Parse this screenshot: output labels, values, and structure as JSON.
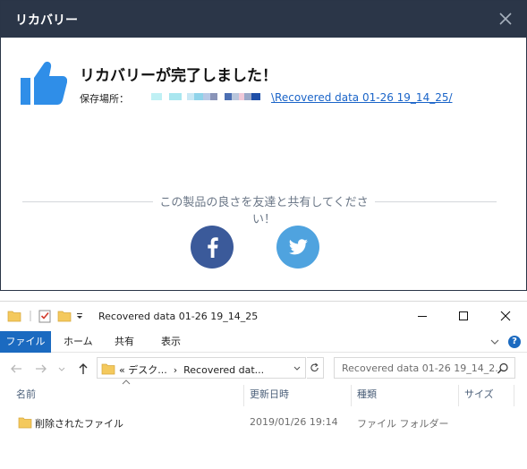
{
  "dialog": {
    "title": "リカバリー",
    "heading": "リカバリーが完了しました！",
    "save_label": "保存場所：",
    "save_path": "\\Recovered data 01-26 19_14_25/",
    "share_text": "この製品の良さを友達と共有してください！",
    "close_icon": "close-icon",
    "facebook_icon": "facebook-icon",
    "twitter_icon": "twitter-icon",
    "accent": "#2f8ee8",
    "title_bar_color": "#2b3648"
  },
  "explorer": {
    "window_title": "Recovered data 01-26 19_14_25",
    "ribbon_tabs": [
      "ファイル",
      "ホーム",
      "共有",
      "表示"
    ],
    "address": {
      "prefix": "«",
      "crumbs": [
        "デスク...",
        "Recovered dat..."
      ]
    },
    "search_placeholder": "Recovered data 01-26 19_14_2...",
    "columns": [
      "名前",
      "更新日時",
      "種類",
      "サイズ"
    ],
    "rows": [
      {
        "name": "削除されたファイル",
        "modified": "2019/01/26 19:14",
        "type": "ファイル フォルダー"
      }
    ],
    "help_label": "?",
    "file_tab_color": "#1b6ac0"
  }
}
